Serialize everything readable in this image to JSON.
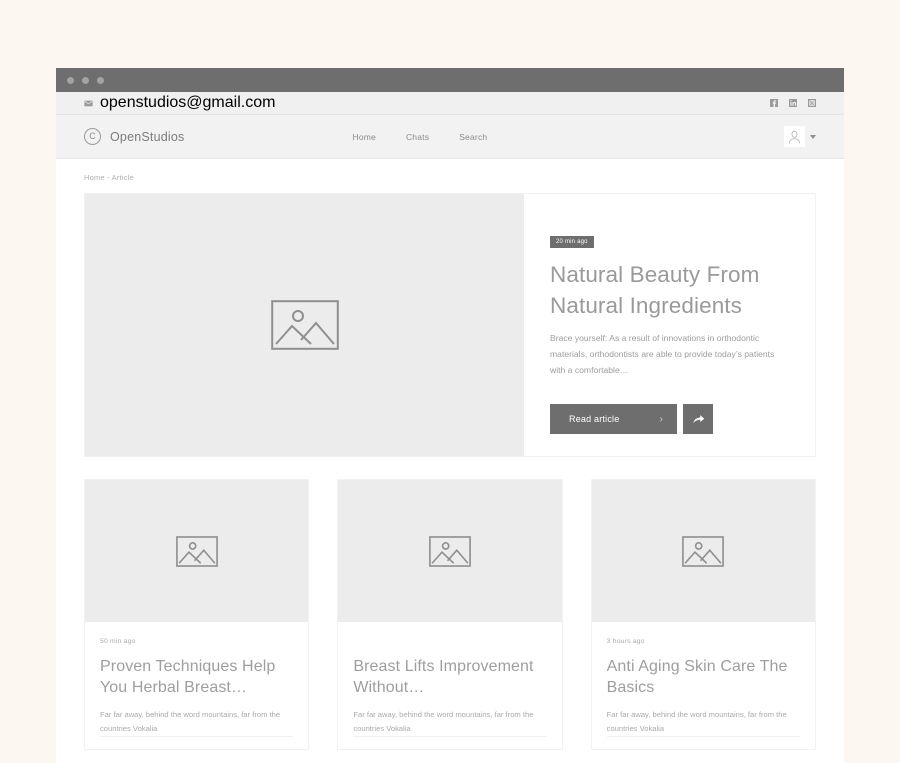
{
  "window": {
    "dots": [
      "close-dot",
      "minimize-dot",
      "maximize-dot"
    ]
  },
  "topbar": {
    "mail_icon": "mail-icon",
    "email": "openstudios@gmail.com",
    "social": [
      {
        "icon": "facebook-icon",
        "name": "Facebook"
      },
      {
        "icon": "linkedin-icon",
        "name": "LinkedIn"
      },
      {
        "icon": "instagram-icon",
        "name": "Instagram"
      }
    ]
  },
  "navbar": {
    "brand_mark": "C",
    "brand_name": "OpenStudios",
    "links": [
      {
        "label": "Home"
      },
      {
        "label": "Chats"
      },
      {
        "label": "Search"
      }
    ],
    "avatar_icon": "user-avatar-icon",
    "caret_icon": "chevron-down-icon"
  },
  "breadcrumb": "Home - Article",
  "hero": {
    "image_placeholder": "image-placeholder-icon",
    "badge": "20 min ago",
    "title": "Natural Beauty From Natural Ingredients",
    "excerpt": "Brace yourself: As a result of innovations in orthodontic materials, orthodontists are able to provide today’s patients with a comfortable…",
    "read_label": "Read article",
    "read_chevron": "›",
    "share_icon": "share-arrow-icon"
  },
  "cards": [
    {
      "image_placeholder": "image-placeholder-icon",
      "meta": "50 min ago",
      "title": "Proven Techniques Help You Herbal Breast…",
      "excerpt": "Far far away, behind the word mountains, far from the countries Vokalia"
    },
    {
      "image_placeholder": "image-placeholder-icon",
      "meta": "",
      "title": "Breast Lifts Improvement Without…",
      "excerpt": "Far far away, behind the word mountains, far from the countries Vokalia"
    },
    {
      "image_placeholder": "image-placeholder-icon",
      "meta": "3 hours ago",
      "title": "Anti Aging Skin Care The Basics",
      "excerpt": "Far far away, behind the word mountains, far from the countries Vokalia"
    }
  ],
  "colors": {
    "page_background": "#fdf7f2",
    "titlebar": "#6e6e6e",
    "accent_dark": "#6e6e6e",
    "media_placeholder": "#ececec",
    "text_muted": "#9e9e9e"
  }
}
